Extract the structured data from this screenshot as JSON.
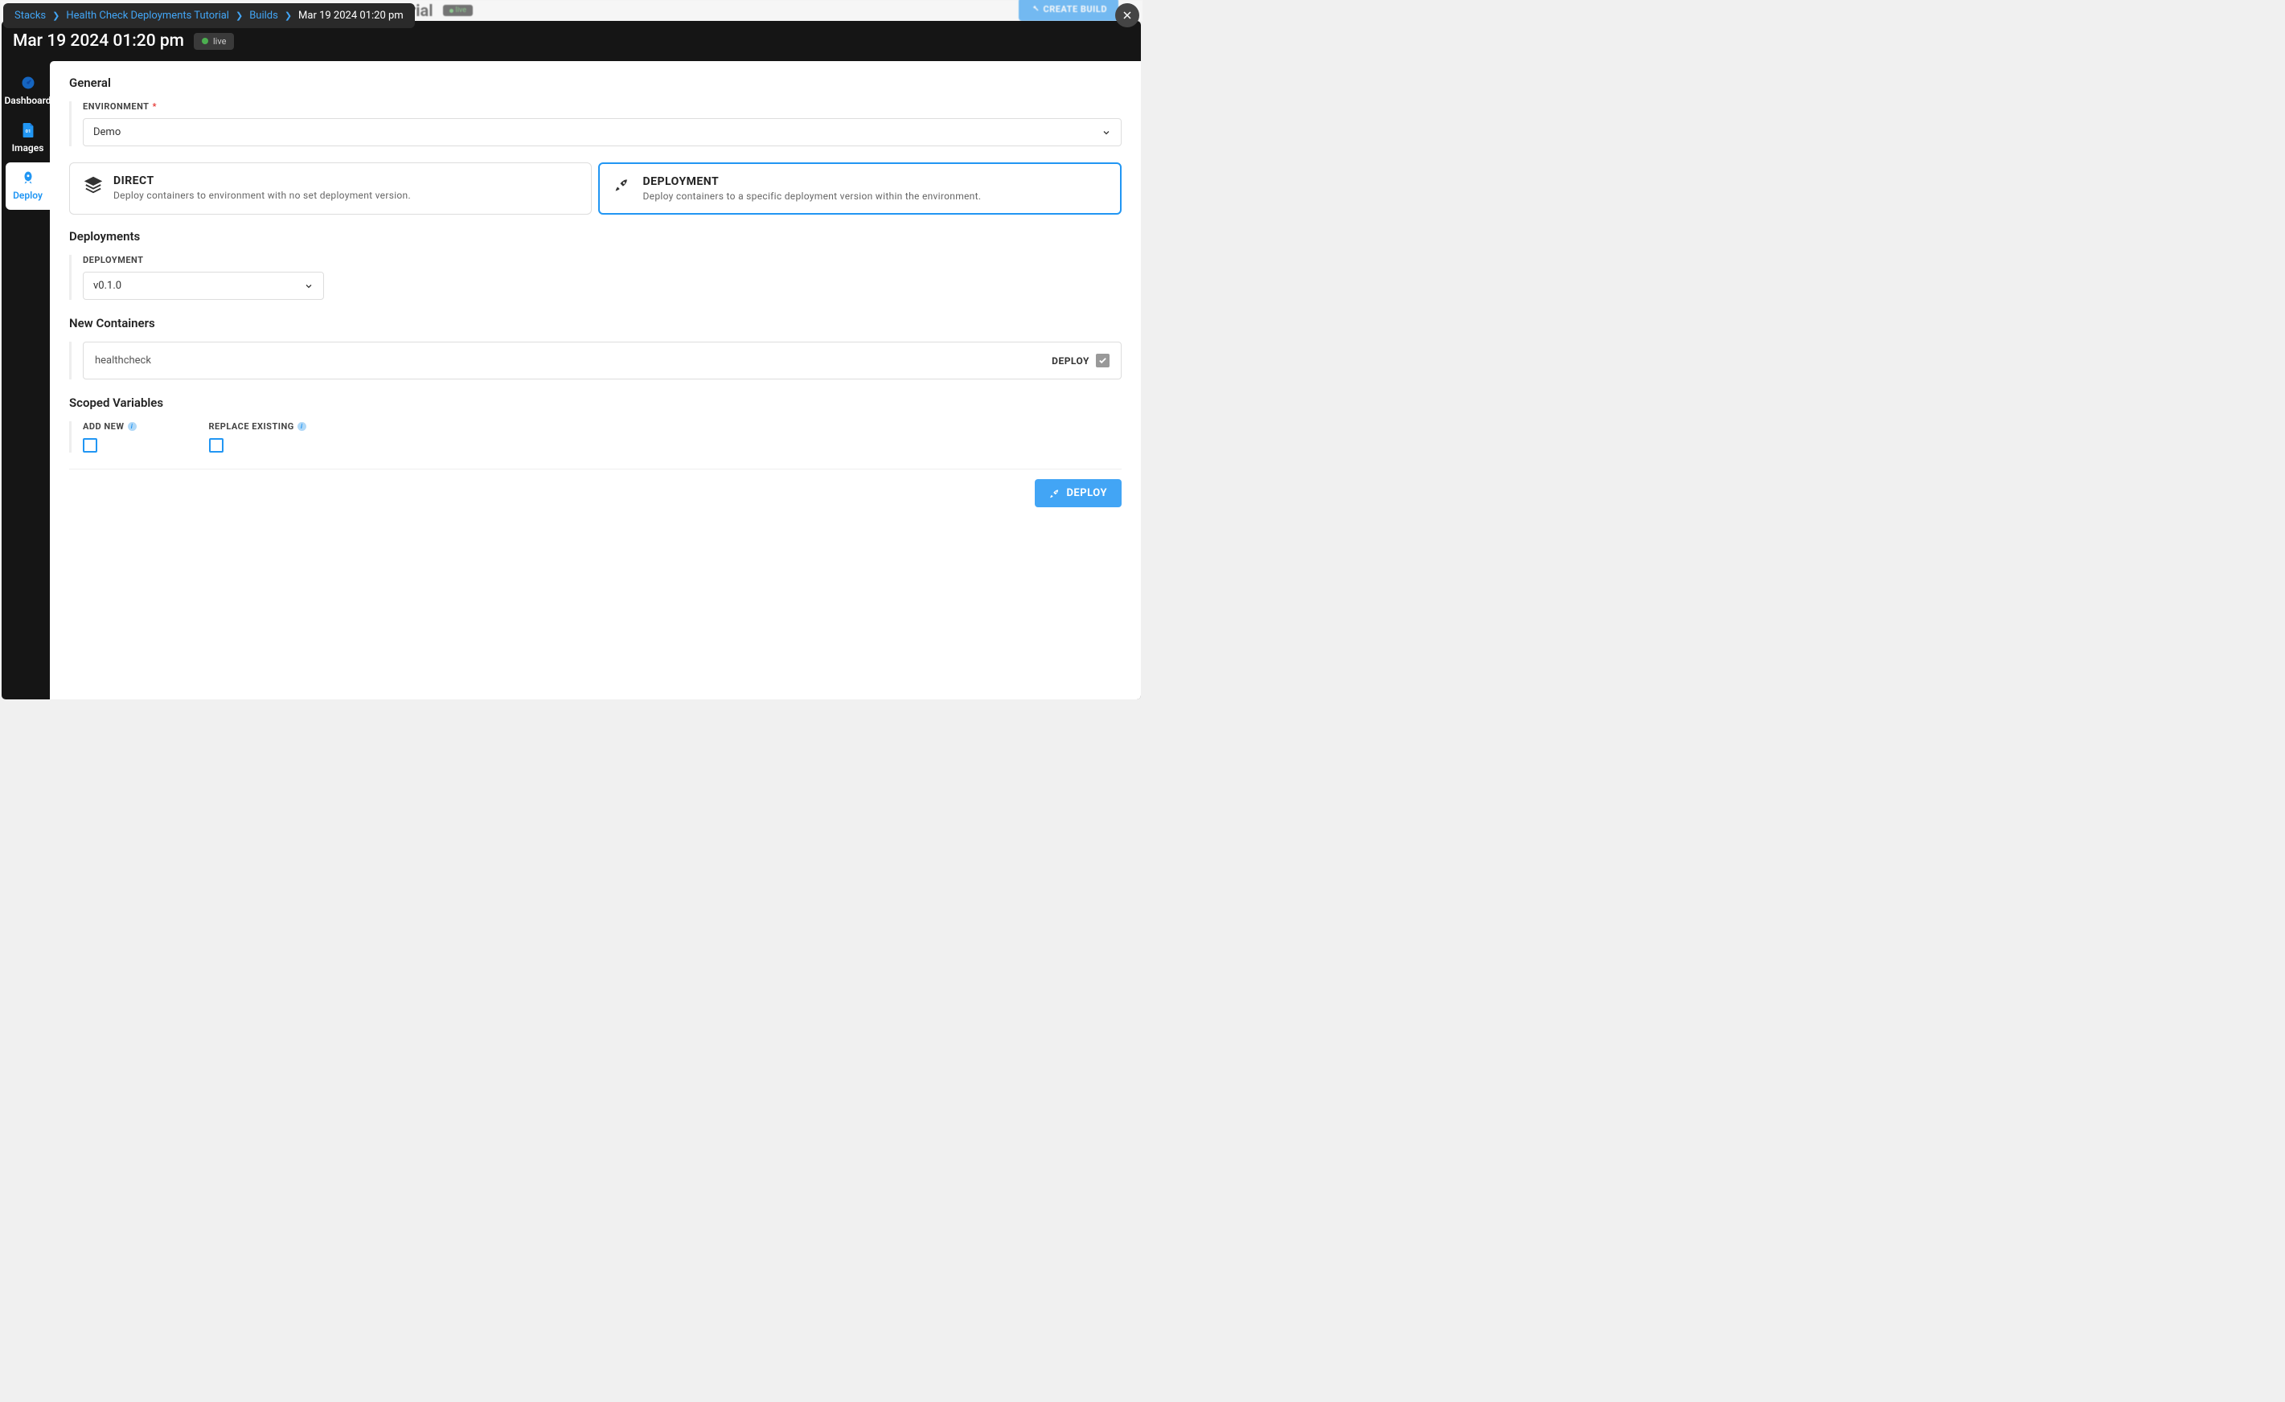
{
  "bg": {
    "title": "eck Deployments Tutorial",
    "badge": "live",
    "create": "CREATE BUILD"
  },
  "breadcrumb": {
    "items": [
      "Stacks",
      "Health Check Deployments Tutorial",
      "Builds"
    ],
    "current": "Mar 19 2024 01:20 pm"
  },
  "modal": {
    "title": "Mar 19 2024 01:20 pm",
    "live": "live"
  },
  "tabs": {
    "dashboard": "Dashboard",
    "images": "Images",
    "deploy": "Deploy"
  },
  "sections": {
    "general": "General",
    "deployments": "Deployments",
    "newContainers": "New Containers",
    "scopedVariables": "Scoped Variables"
  },
  "general": {
    "envLabel": "ENVIRONMENT",
    "envValue": "Demo"
  },
  "cards": {
    "direct": {
      "title": "DIRECT",
      "desc": "Deploy containers to environment with no set deployment version."
    },
    "deployment": {
      "title": "DEPLOYMENT",
      "desc": "Deploy containers to a specific deployment version within the environment."
    }
  },
  "deployments": {
    "label": "DEPLOYMENT",
    "value": "v0.1.0"
  },
  "containers": [
    {
      "name": "healthcheck",
      "deployLabel": "DEPLOY",
      "checked": true
    }
  ],
  "scoped": {
    "addNew": "ADD NEW",
    "replace": "REPLACE EXISTING"
  },
  "footer": {
    "deploy": "DEPLOY"
  }
}
